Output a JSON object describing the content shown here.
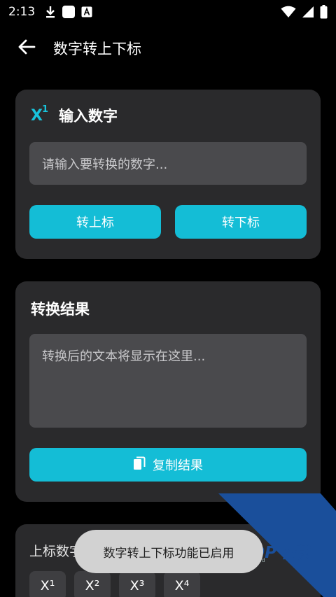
{
  "status_bar": {
    "time": "2:13",
    "left_icons": [
      "download-icon",
      "square-app-icon",
      "a-box-icon"
    ],
    "right_icons": [
      "wifi-icon",
      "signal-icon",
      "battery-icon"
    ]
  },
  "app_bar": {
    "title": "数字转上下标",
    "back_icon": "arrow-left-icon"
  },
  "input_card": {
    "icon": "superscript-icon",
    "icon_text": "X",
    "icon_sup": "1",
    "title": "输入数字",
    "input_placeholder": "请输入要转换的数字...",
    "superscript_button": "转上标",
    "subscript_button": "转下标"
  },
  "result_card": {
    "title": "转换结果",
    "output_placeholder": "转换后的文本将显示在这里...",
    "copy_button": "复制结果",
    "copy_icon": "copy-icon"
  },
  "superscript_card": {
    "title": "上标数字示",
    "chips": [
      "X¹",
      "X²",
      "X³",
      "X⁴"
    ]
  },
  "toast": {
    "message": "数字转上下标功能已启用"
  },
  "watermark": {
    "brand": "PCPOP下载",
    "sub": "PCPOP Download"
  },
  "colors": {
    "background": "#000000",
    "card": "#2a2a2c",
    "field": "#4a4a4d",
    "accent": "#14bdd6",
    "watermark_blue": "#1a4f9b"
  }
}
